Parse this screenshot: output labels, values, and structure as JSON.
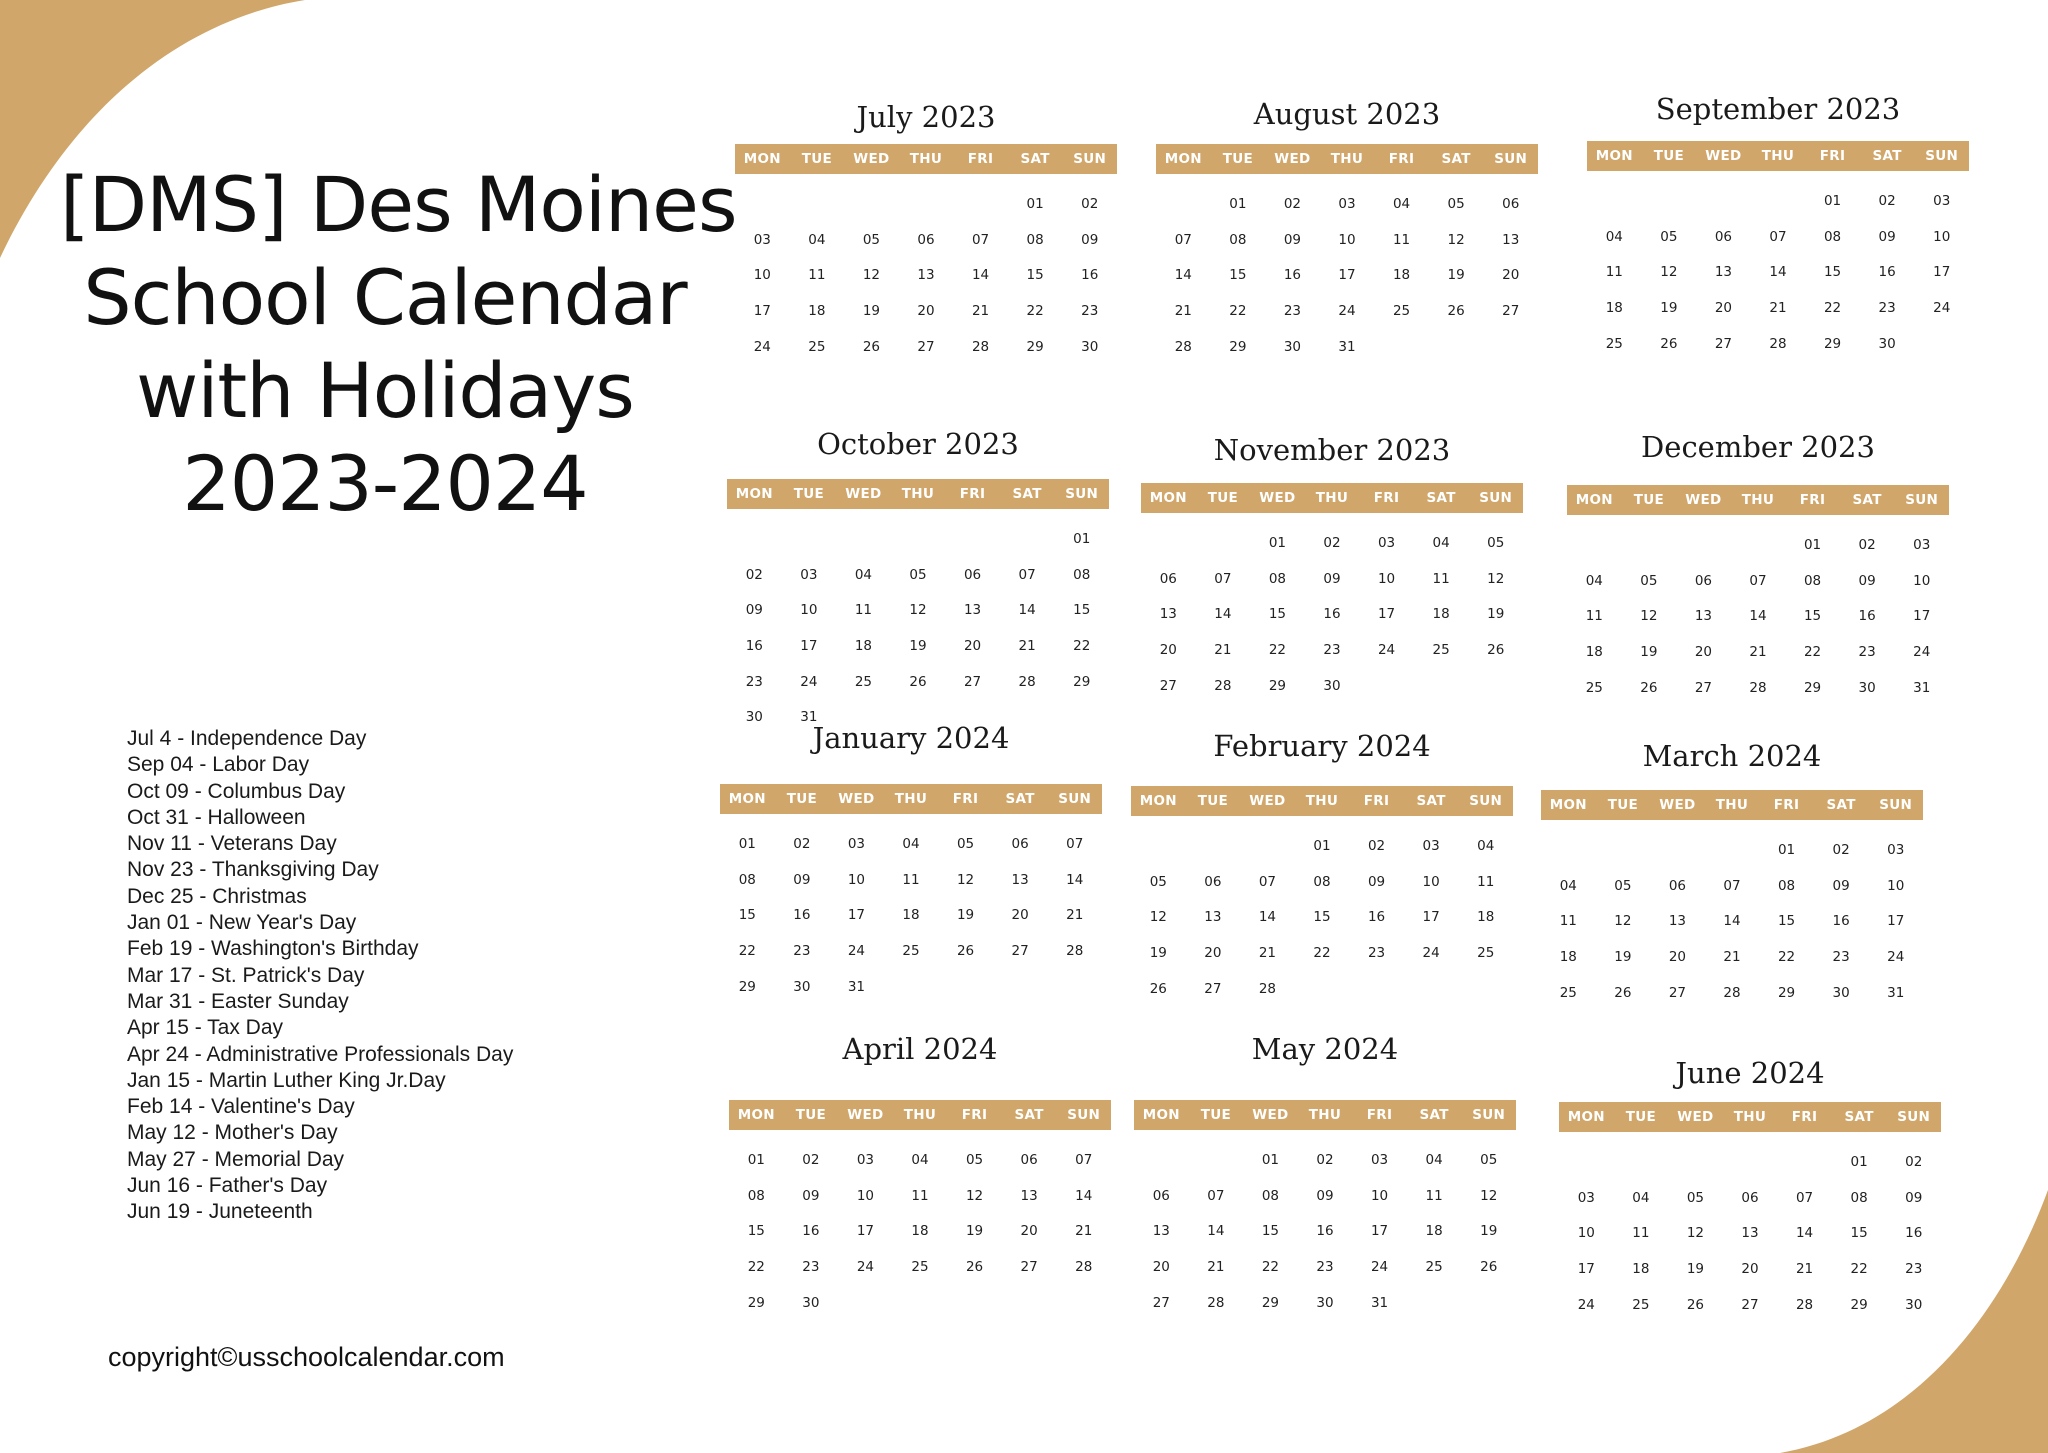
{
  "title_lines": [
    "[DMS] Des Moines",
    "School Calendar",
    "with Holidays",
    "2023-2024"
  ],
  "accent_color": "#D0A66A",
  "weekday_labels": [
    "MON",
    "TUE",
    "WED",
    "THU",
    "FRI",
    "SAT",
    "SUN"
  ],
  "months": [
    {
      "title": "July 2023",
      "offset": 5,
      "days": [
        "01",
        "02",
        "03",
        "04",
        "05",
        "06",
        "07",
        "08",
        "09",
        "10",
        "11",
        "12",
        "13",
        "14",
        "15",
        "16",
        "17",
        "18",
        "19",
        "20",
        "21",
        "22",
        "23",
        "24",
        "25",
        "26",
        "27",
        "28",
        "29",
        "30"
      ]
    },
    {
      "title": "August 2023",
      "offset": 1,
      "days": [
        "01",
        "02",
        "03",
        "04",
        "05",
        "06",
        "07",
        "08",
        "09",
        "10",
        "11",
        "12",
        "13",
        "14",
        "15",
        "16",
        "17",
        "18",
        "19",
        "20",
        "21",
        "22",
        "23",
        "24",
        "25",
        "26",
        "27",
        "28",
        "29",
        "30",
        "31"
      ]
    },
    {
      "title": "September 2023",
      "offset": 4,
      "days": [
        "01",
        "02",
        "03",
        "04",
        "05",
        "06",
        "07",
        "08",
        "09",
        "10",
        "11",
        "12",
        "13",
        "14",
        "15",
        "16",
        "17",
        "18",
        "19",
        "20",
        "21",
        "22",
        "23",
        "24",
        "25",
        "26",
        "27",
        "28",
        "29",
        "30"
      ]
    },
    {
      "title": "October 2023",
      "offset": 6,
      "days": [
        "01",
        "02",
        "03",
        "04",
        "05",
        "06",
        "07",
        "08",
        "09",
        "10",
        "11",
        "12",
        "13",
        "14",
        "15",
        "16",
        "17",
        "18",
        "19",
        "20",
        "21",
        "22",
        "23",
        "24",
        "25",
        "26",
        "27",
        "28",
        "29",
        "30",
        "31"
      ]
    },
    {
      "title": "November 2023",
      "offset": 2,
      "days": [
        "01",
        "02",
        "03",
        "04",
        "05",
        "06",
        "07",
        "08",
        "09",
        "10",
        "11",
        "12",
        "13",
        "14",
        "15",
        "16",
        "17",
        "18",
        "19",
        "20",
        "21",
        "22",
        "23",
        "24",
        "25",
        "26",
        "27",
        "28",
        "29",
        "30"
      ]
    },
    {
      "title": "December 2023",
      "offset": 4,
      "days": [
        "01",
        "02",
        "03",
        "04",
        "05",
        "06",
        "07",
        "08",
        "09",
        "10",
        "11",
        "12",
        "13",
        "14",
        "15",
        "16",
        "17",
        "18",
        "19",
        "20",
        "21",
        "22",
        "23",
        "24",
        "25",
        "26",
        "27",
        "28",
        "29",
        "30",
        "31"
      ]
    },
    {
      "title": "January 2024",
      "offset": 0,
      "days": [
        "01",
        "02",
        "03",
        "04",
        "05",
        "06",
        "07",
        "08",
        "09",
        "10",
        "11",
        "12",
        "13",
        "14",
        "15",
        "16",
        "17",
        "18",
        "19",
        "20",
        "21",
        "22",
        "23",
        "24",
        "25",
        "26",
        "27",
        "28",
        "29",
        "30",
        "31"
      ]
    },
    {
      "title": "February 2024",
      "offset": 3,
      "days": [
        "01",
        "02",
        "03",
        "04",
        "05",
        "06",
        "07",
        "08",
        "09",
        "10",
        "11",
        "12",
        "13",
        "14",
        "15",
        "16",
        "17",
        "18",
        "19",
        "20",
        "21",
        "22",
        "23",
        "24",
        "25",
        "26",
        "27",
        "28"
      ]
    },
    {
      "title": "March 2024",
      "offset": 4,
      "days": [
        "01",
        "02",
        "03",
        "04",
        "05",
        "06",
        "07",
        "08",
        "09",
        "10",
        "11",
        "12",
        "13",
        "14",
        "15",
        "16",
        "17",
        "18",
        "19",
        "20",
        "21",
        "22",
        "23",
        "24",
        "25",
        "26",
        "27",
        "28",
        "29",
        "30",
        "31"
      ]
    },
    {
      "title": "April 2024",
      "offset": 0,
      "days": [
        "01",
        "02",
        "03",
        "04",
        "05",
        "06",
        "07",
        "08",
        "09",
        "10",
        "11",
        "12",
        "13",
        "14",
        "15",
        "16",
        "17",
        "18",
        "19",
        "20",
        "21",
        "22",
        "23",
        "24",
        "25",
        "26",
        "27",
        "28",
        "29",
        "30"
      ]
    },
    {
      "title": "May 2024",
      "offset": 2,
      "days": [
        "01",
        "02",
        "03",
        "04",
        "05",
        "06",
        "07",
        "08",
        "09",
        "10",
        "11",
        "12",
        "13",
        "14",
        "15",
        "16",
        "17",
        "18",
        "19",
        "20",
        "21",
        "22",
        "23",
        "24",
        "25",
        "26",
        "27",
        "28",
        "29",
        "30",
        "31"
      ]
    },
    {
      "title": "June 2024",
      "offset": 5,
      "days": [
        "01",
        "02",
        "03",
        "04",
        "05",
        "06",
        "07",
        "08",
        "09",
        "10",
        "11",
        "12",
        "13",
        "14",
        "15",
        "16",
        "17",
        "18",
        "19",
        "20",
        "21",
        "22",
        "23",
        "24",
        "25",
        "26",
        "27",
        "28",
        "29",
        "30"
      ]
    }
  ],
  "holidays": [
    "Jul 4 - Independence Day",
    "Sep 04 - Labor Day",
    "Oct 09 - Columbus Day",
    "Oct 31 - Halloween",
    "Nov 11 - Veterans Day",
    "Nov 23 - Thanksgiving Day",
    "Dec 25 - Christmas",
    "Jan 01 - New Year's Day",
    "Feb 19 - Washington's Birthday",
    "Mar 17 - St. Patrick's Day",
    "Mar 31 - Easter Sunday",
    "Apr 15 - Tax Day",
    "Apr 24 - Administrative Professionals Day",
    "Jan 15 - Martin Luther King Jr.Day",
    "Feb 14 - Valentine's Day",
    "May 12 - Mother's Day",
    "May 27 - Memorial Day",
    "Jun 16 - Father's Day",
    "Jun 19 - Juneteenth"
  ],
  "copyright": "copyright©usschoolcalendar.com"
}
